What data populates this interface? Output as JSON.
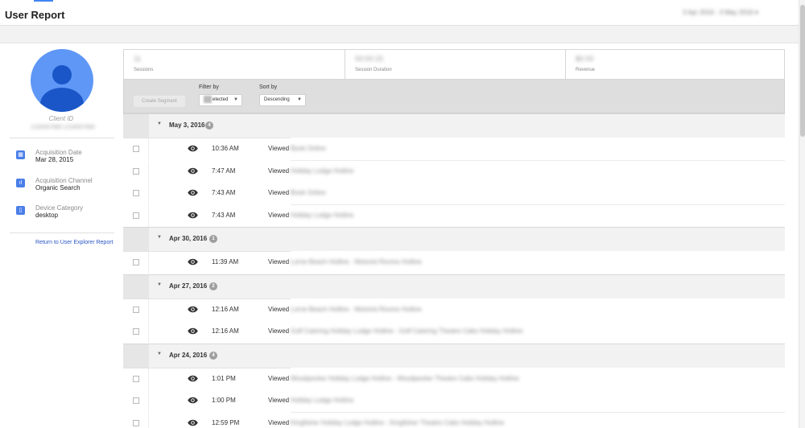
{
  "header": {
    "title": "User Report",
    "date_range": "3 Apr 2016 - 3 May 2016 ▾"
  },
  "profile": {
    "client_id_label": "Client ID",
    "client_id_value": "1234567890.1234567890",
    "items": [
      {
        "icon": "calendar-icon",
        "glyph": "▦",
        "title": "Acquisition Date",
        "value": "Mar 28, 2015"
      },
      {
        "icon": "bar-chart-icon",
        "glyph": "ıl",
        "title": "Acquisition Channel",
        "value": "Organic Search"
      },
      {
        "icon": "device-icon",
        "glyph": "▯",
        "title": "Device Category",
        "value": "desktop"
      }
    ],
    "return_link": "Return to User Explorer Report"
  },
  "metrics": [
    {
      "label": "Sessions",
      "value": "11"
    },
    {
      "label": "Session Duration",
      "value": "00:00:15"
    },
    {
      "label": "Revenue",
      "value": "$0.00"
    }
  ],
  "toolbar": {
    "create_segment": "Create Segment",
    "filter_label": "Filter by",
    "filter_value": "elected",
    "sort_label": "Sort by",
    "sort_value": "Descending"
  },
  "groups": [
    {
      "date": "May 3, 2016",
      "count": "4",
      "hits": [
        {
          "time": "10:36 AM",
          "action": "Viewed",
          "page": "Book Online"
        },
        {
          "time": "7:47 AM",
          "action": "Viewed",
          "page": "Holiday Lodge Hotline"
        },
        {
          "time": "7:43 AM",
          "action": "Viewed",
          "page": "Book Online"
        },
        {
          "time": "7:43 AM",
          "action": "Viewed",
          "page": "Holiday Lodge Hotline"
        }
      ]
    },
    {
      "date": "Apr 30, 2016",
      "count": "1",
      "hits": [
        {
          "time": "11:39 AM",
          "action": "Viewed",
          "page": "Lorne Beach Hotline - Motorist Rooms Hotline"
        }
      ]
    },
    {
      "date": "Apr 27, 2016",
      "count": "2",
      "hits": [
        {
          "time": "12:16 AM",
          "action": "Viewed",
          "page": "Lorne Beach Hotline - Motorist Rooms Hotline"
        },
        {
          "time": "12:16 AM",
          "action": "Viewed",
          "page": "Golf Catering Holiday Lodge Hotline - Golf Catering Theatre Cabs Holiday Hotline"
        }
      ]
    },
    {
      "date": "Apr 24, 2016",
      "count": "4",
      "hits": [
        {
          "time": "1:01 PM",
          "action": "Viewed",
          "page": "Woodpecker Holiday Lodge Hotline - Woodpecker Theatre Cabs Holiday Hotline"
        },
        {
          "time": "1:00 PM",
          "action": "Viewed",
          "page": "Holiday Lodge Hotline"
        },
        {
          "time": "12:59 PM",
          "action": "Viewed",
          "page": "Kingfisher Holiday Lodge Hotline - Kingfisher Theatre Cabs Holiday Hotline"
        }
      ]
    }
  ]
}
